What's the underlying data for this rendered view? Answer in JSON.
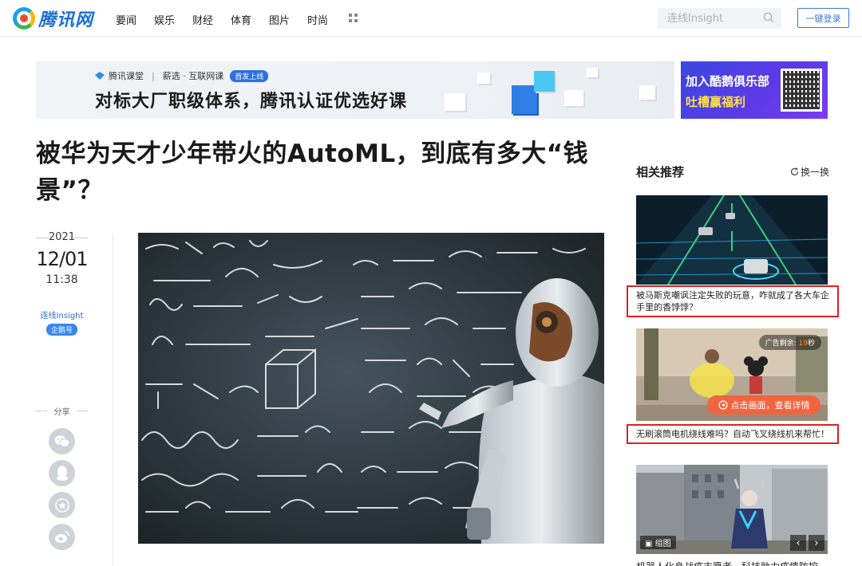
{
  "header": {
    "logo_text": "腾讯网",
    "nav": [
      "要闻",
      "娱乐",
      "财经",
      "体育",
      "图片",
      "时尚"
    ],
    "search_placeholder": "连线Insight",
    "login_label": "一键登录"
  },
  "banner": {
    "brand": "腾讯课堂",
    "sub_brand": "薪选 · 互联网课",
    "tag": "首发上线",
    "headline": "对标大厂职级体系，腾讯认证优选好课",
    "side_line1": "加入酷鹅俱乐部",
    "side_line2": "吐槽赢福利"
  },
  "article": {
    "title": "被华为天才少年带火的AutoML，到底有多大“钱景”？",
    "year": "2021",
    "date": "12/01",
    "time": "11:38",
    "author": "连线Insight",
    "author_badge": "企鹅号",
    "share_label": "分享"
  },
  "sidebar": {
    "title": "相关推荐",
    "refresh_label": "换一换",
    "items": [
      {
        "caption": "被马斯克嘲讽注定失败的玩意，咋就成了各大车企手里的香饽饽？"
      },
      {
        "caption": "无刷滚筒电机绕线难吗？自动飞叉绕线机来帮忙！",
        "ad_prefix": "广告剩余:",
        "ad_seconds": "19",
        "ad_suffix": "秒",
        "ad_button": "点击画面，查看详情"
      },
      {
        "gallery_tag": "组图",
        "caption_partial": "机器人化身战疫志愿者，科技助力疫情防控"
      }
    ]
  },
  "colors": {
    "brand_blue": "#1a6fd6",
    "highlight_red": "#e02020",
    "accent_orange": "#f2643f"
  }
}
